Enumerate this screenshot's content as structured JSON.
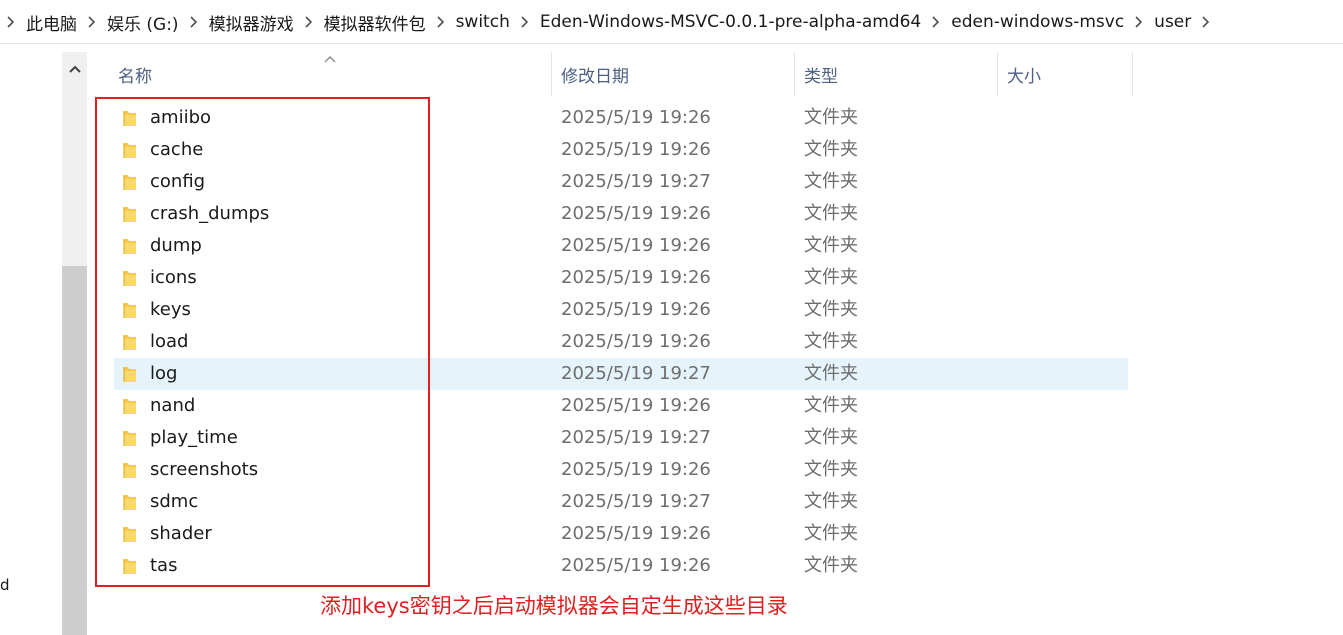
{
  "breadcrumb": [
    "此电脑",
    "娱乐 (G:)",
    "模拟器游戏",
    "模拟器软件包",
    "switch",
    "Eden-Windows-MSVC-0.0.1-pre-alpha-amd64",
    "eden-windows-msvc",
    "user"
  ],
  "columns": {
    "name": "名称",
    "modified": "修改日期",
    "type": "类型",
    "size": "大小"
  },
  "nav_pane": {
    "partial_text": "d"
  },
  "files": [
    {
      "name": "amiibo",
      "modified": "2025/5/19 19:26",
      "type": "文件夹"
    },
    {
      "name": "cache",
      "modified": "2025/5/19 19:26",
      "type": "文件夹"
    },
    {
      "name": "config",
      "modified": "2025/5/19 19:27",
      "type": "文件夹"
    },
    {
      "name": "crash_dumps",
      "modified": "2025/5/19 19:26",
      "type": "文件夹"
    },
    {
      "name": "dump",
      "modified": "2025/5/19 19:26",
      "type": "文件夹"
    },
    {
      "name": "icons",
      "modified": "2025/5/19 19:26",
      "type": "文件夹"
    },
    {
      "name": "keys",
      "modified": "2025/5/19 19:26",
      "type": "文件夹"
    },
    {
      "name": "load",
      "modified": "2025/5/19 19:26",
      "type": "文件夹"
    },
    {
      "name": "log",
      "modified": "2025/5/19 19:27",
      "type": "文件夹",
      "selected": true
    },
    {
      "name": "nand",
      "modified": "2025/5/19 19:26",
      "type": "文件夹"
    },
    {
      "name": "play_time",
      "modified": "2025/5/19 19:27",
      "type": "文件夹"
    },
    {
      "name": "screenshots",
      "modified": "2025/5/19 19:26",
      "type": "文件夹"
    },
    {
      "name": "sdmc",
      "modified": "2025/5/19 19:27",
      "type": "文件夹"
    },
    {
      "name": "shader",
      "modified": "2025/5/19 19:26",
      "type": "文件夹"
    },
    {
      "name": "tas",
      "modified": "2025/5/19 19:26",
      "type": "文件夹"
    }
  ],
  "annotation": {
    "text": "添加keys密钥之后启动模拟器会自定生成这些目录",
    "color": "#e02020"
  },
  "colors": {
    "selection": "#e5f3fb",
    "header_text": "#4d6082",
    "folder": "#f8c94a"
  },
  "icons": {
    "folder": "folder-icon",
    "breadcrumb_separator": "chevron-right-icon",
    "scroll_up": "chevron-up-icon",
    "sort": "sort-ascending-icon"
  }
}
